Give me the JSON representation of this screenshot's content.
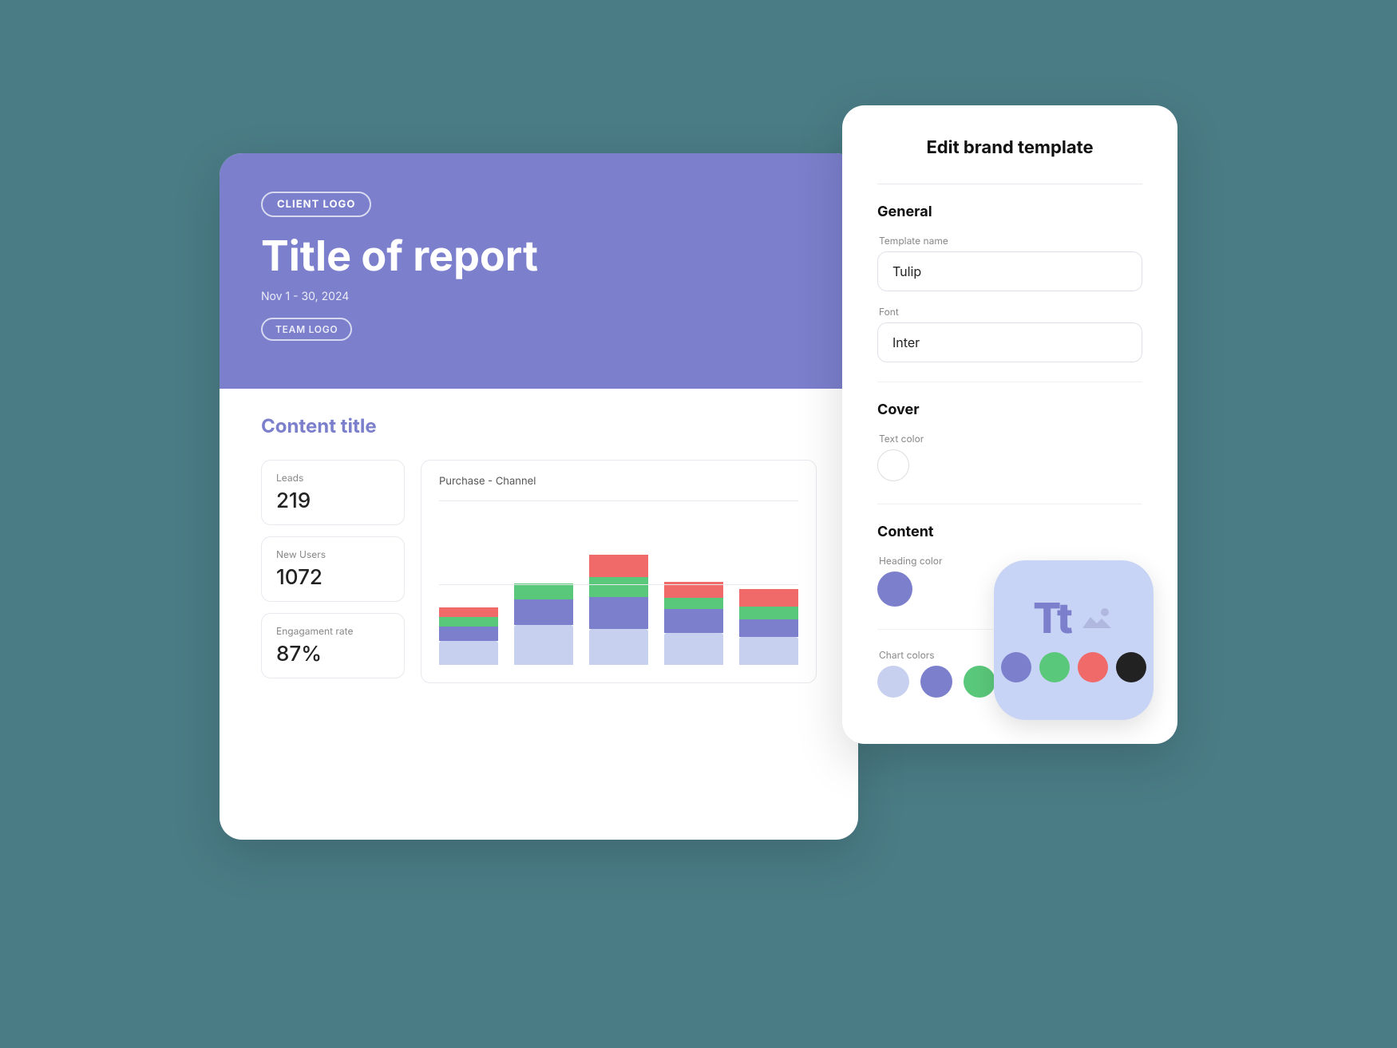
{
  "background_color": "#4a7c85",
  "report": {
    "cover": {
      "client_logo_label": "CLIENT LOGO",
      "title": "Title of report",
      "date_range": "Nov 1 - 30, 2024",
      "team_logo_label": "TEAM LOGO",
      "bg_color": "#7b7fcc"
    },
    "content": {
      "section_title": "Content title",
      "stats": [
        {
          "label": "Leads",
          "value": "219"
        },
        {
          "label": "New Users",
          "value": "1072"
        },
        {
          "label": "Engagament rate",
          "value": "87%"
        }
      ],
      "chart": {
        "title": "Purchase - Channel",
        "bars": [
          {
            "light": 30,
            "medium": 18,
            "green": 12,
            "red": 12
          },
          {
            "light": 50,
            "medium": 32,
            "green": 20,
            "red": 0
          },
          {
            "light": 45,
            "medium": 40,
            "green": 25,
            "red": 28
          },
          {
            "light": 40,
            "medium": 30,
            "green": 14,
            "red": 20
          },
          {
            "light": 35,
            "medium": 22,
            "green": 16,
            "red": 22
          }
        ]
      }
    }
  },
  "edit_panel": {
    "title": "Edit brand template",
    "sections": {
      "general": {
        "heading": "General",
        "template_name_label": "Template name",
        "template_name_value": "Tulip",
        "font_label": "Font",
        "font_value": "Inter"
      },
      "cover": {
        "heading": "Cover",
        "text_color_label": "Text color",
        "text_color": "#ffffff"
      },
      "content": {
        "heading": "Content",
        "heading_color_label": "Heading color",
        "heading_color": "#7b7fcc",
        "chart_colors_label": "Chart colors",
        "chart_colors": [
          "#c8d0f0",
          "#7b7fcc",
          "#5ac87a",
          "#f06a6a"
        ]
      }
    }
  },
  "brand_icon": {
    "tt_label": "Tt",
    "dots": [
      "#7b7fcc",
      "#5ac87a",
      "#f06a6a",
      "#222222"
    ]
  }
}
